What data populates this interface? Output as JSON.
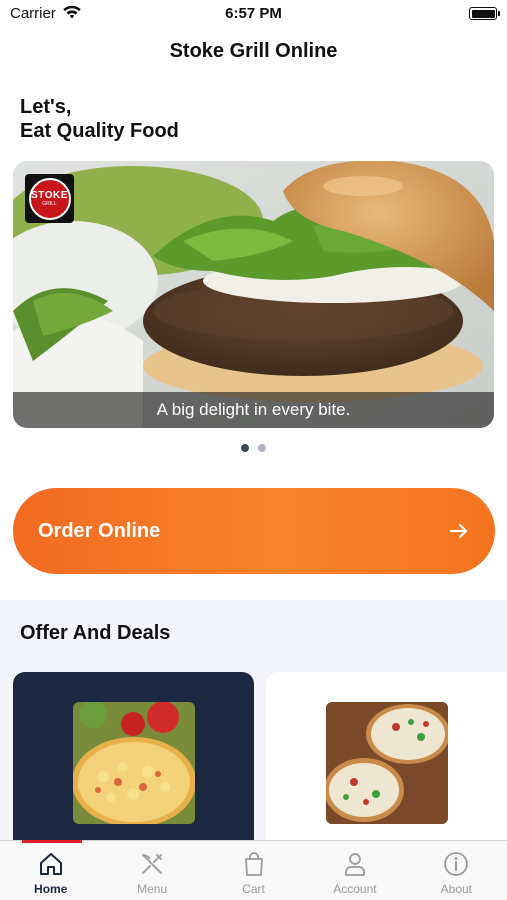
{
  "status": {
    "carrier": "Carrier",
    "time": "6:57 PM"
  },
  "nav": {
    "title": "Stoke Grill Online"
  },
  "greeting": {
    "line1": "Let's,",
    "line2": "Eat Quality Food"
  },
  "banner": {
    "caption": "A big delight in every bite.",
    "logo_text": "STOKE",
    "logo_sub": "GRILL",
    "page_count": 2,
    "active_page": 1
  },
  "order": {
    "label": "Order Online",
    "icon": "arrow-right-icon"
  },
  "offers": {
    "title": "Offer And Deals"
  },
  "tabs": [
    {
      "label": "Home",
      "icon": "home-icon",
      "active": true
    },
    {
      "label": "Menu",
      "icon": "fork-knife-icon",
      "active": false
    },
    {
      "label": "Cart",
      "icon": "shopping-bag-icon",
      "active": false
    },
    {
      "label": "Account",
      "icon": "user-icon",
      "active": false
    },
    {
      "label": "About",
      "icon": "info-icon",
      "active": false
    }
  ],
  "colors": {
    "accent": "#f26a22",
    "navy": "#1c2742",
    "active_tab_indicator": "#e21b2b"
  }
}
